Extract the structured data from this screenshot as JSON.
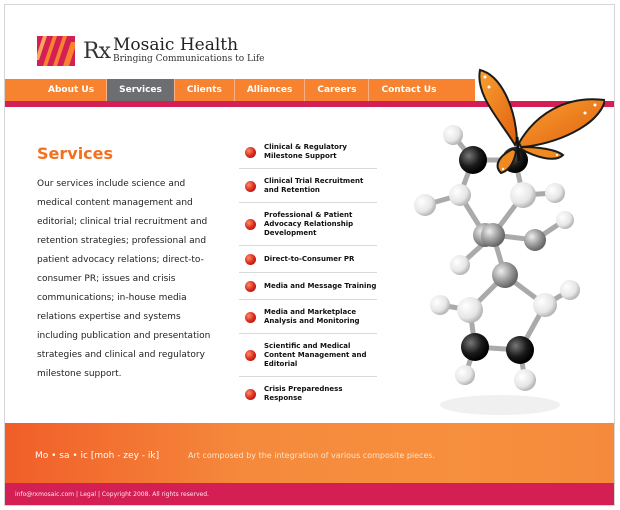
{
  "brand": {
    "rx": "Rx",
    "name": "Mosaic Health",
    "tagline": "Bringing Communications to Life"
  },
  "nav": {
    "items": [
      "About Us",
      "Services",
      "Clients",
      "Alliances",
      "Careers",
      "Contact Us"
    ],
    "active": "Services"
  },
  "main": {
    "heading": "Services",
    "body": "Our services include science and medical content management and editorial; clinical trial recruitment and retention strategies; professional and patient advocacy relations; direct-to-consumer PR; issues and crisis communications; in-house media relations expertise and systems including publication and presentation strategies and clinical and regulatory milestone support."
  },
  "services": [
    "Clinical & Regulatory Milestone Support",
    "Clinical Trial Recruitment and Retention",
    "Professional & Patient Advocacy Relationship Development",
    "Direct-to-Consumer PR",
    "Media and Message Training",
    "Media and Marketplace Analysis and Monitoring",
    "Scientific and Medical Content Management and Editorial",
    "Crisis Preparedness Response"
  ],
  "band": {
    "word": "Mo • sa • ic   [moh - zey - ik]",
    "definition": "Art composed by the integration of various composite pieces."
  },
  "footer": {
    "email": "info@rxmosaic.com",
    "legal": "Legal",
    "copyright": "Copyright 2008. All rights reserved.",
    "sep": " | "
  },
  "colors": {
    "orange": "#f7822f",
    "crimson": "#d41f54",
    "nav_active": "#6d6e71",
    "heading": "#f37021"
  }
}
